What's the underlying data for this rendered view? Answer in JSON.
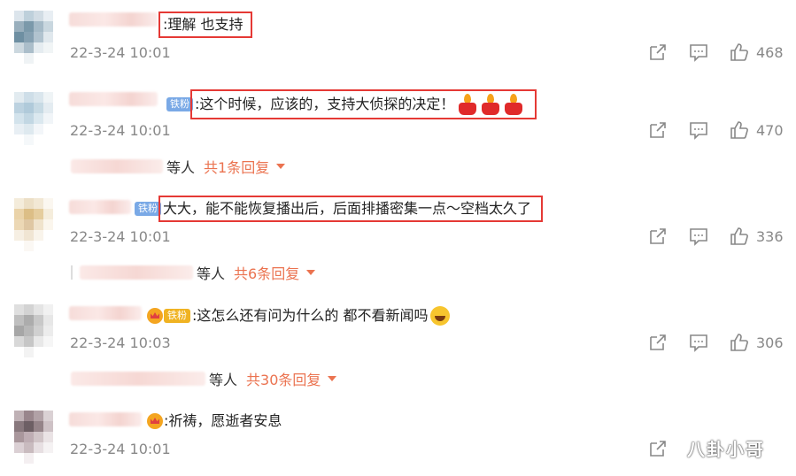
{
  "comments": [
    {
      "text": ":理解 也支持",
      "time": "22-3-24 10:01",
      "likes": "468",
      "has_badge": false
    },
    {
      "badge": "铁粉",
      "text": ":这个时候，应该的，支持大侦探的决定！",
      "time": "22-3-24 10:01",
      "likes": "470",
      "reply": {
        "suffix": "等人",
        "count": "共1条回复"
      }
    },
    {
      "badge": "铁粉",
      "text": "大大，能不能恢复播出后，后面排播密集一点～空档太久了",
      "time": "22-3-24 10:01",
      "likes": "336",
      "reply": {
        "suffix": "等人",
        "count": "共6条回复"
      }
    },
    {
      "badge": "铁粉",
      "text": ":这怎么还有问为什么的 都不看新闻吗",
      "time": "22-3-24 10:03",
      "likes": "306",
      "reply": {
        "suffix": "等人",
        "count": "共30条回复"
      }
    },
    {
      "text": ":祈祷，愿逝者安息",
      "time": "22-3-24 10:01",
      "likes": ""
    }
  ],
  "watermark": "八卦小哥",
  "icons": {
    "share": "share-icon",
    "comment": "comment-icon",
    "like": "thumbs-up-icon"
  },
  "colors": {
    "highlight": "#e53935",
    "reply_accent": "#eb7350",
    "badge_blue": "#7aa9e6"
  }
}
